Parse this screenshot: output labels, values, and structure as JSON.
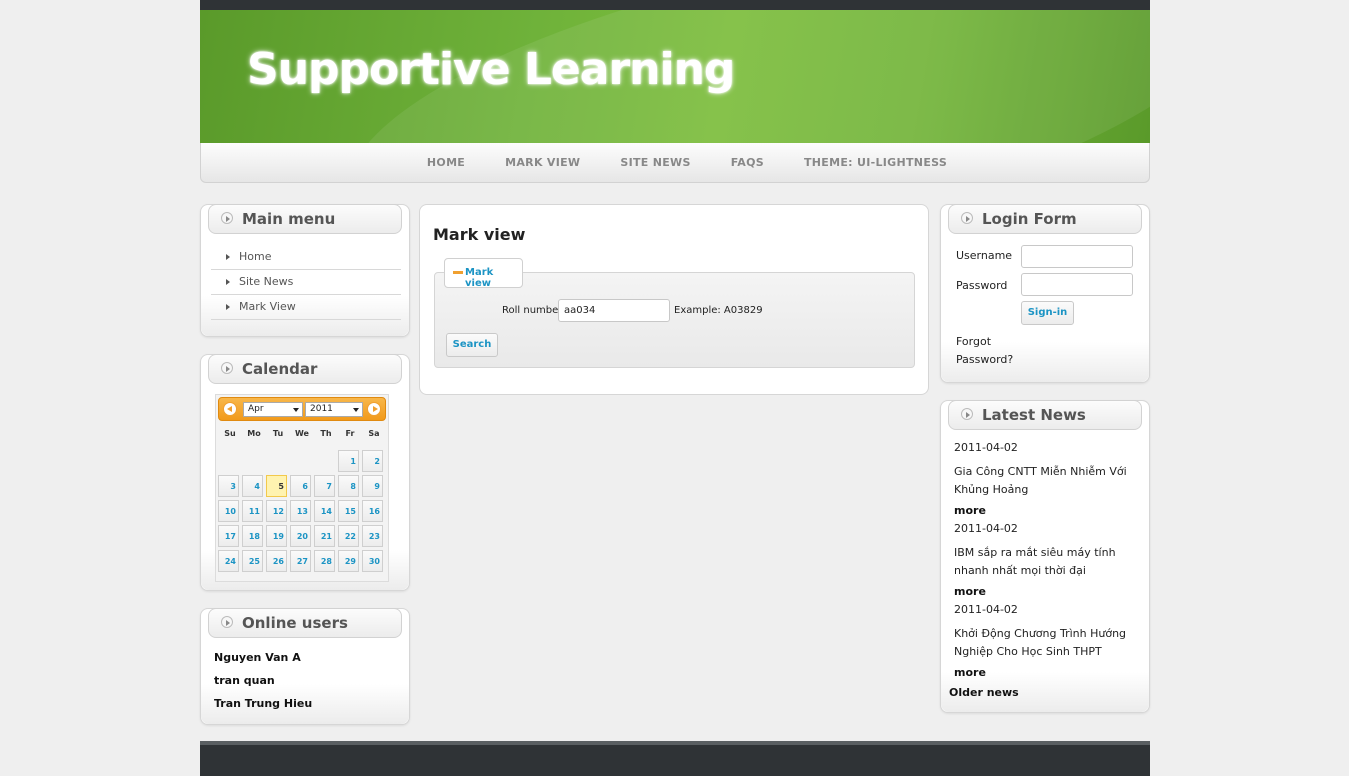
{
  "site": {
    "title": "Supportive Learning"
  },
  "nav": {
    "items": [
      "HOME",
      "MARK VIEW",
      "SITE NEWS",
      "FAQS",
      "THEME: UI-LIGHTNESS"
    ]
  },
  "main_menu": {
    "title": "Main menu",
    "items": [
      "Home",
      "Site News",
      "Mark View"
    ]
  },
  "calendar": {
    "title": "Calendar",
    "month": "Apr",
    "year": "2011",
    "weekdays": [
      "Su",
      "Mo",
      "Tu",
      "We",
      "Th",
      "Fr",
      "Sa"
    ],
    "first_weekday_index": 5,
    "days_in_month": 30,
    "today": 5
  },
  "online_users": {
    "title": "Online users",
    "users": [
      "Nguyen Van A",
      "tran quan",
      "Tran Trung Hieu"
    ]
  },
  "content": {
    "heading": "Mark view",
    "legend": "Mark view",
    "roll_label": "Roll number",
    "roll_value": "aa034",
    "example": "Example: A03829",
    "search_button": "Search"
  },
  "login": {
    "title": "Login Form",
    "username_label": "Username",
    "password_label": "Password",
    "signin_button": "Sign-in",
    "forgot": "Forgot Password?"
  },
  "latest_news": {
    "title": "Latest News",
    "items": [
      {
        "date": "2011-04-02",
        "title": "Gia Công CNTT Miễn Nhiễm Với Khủng Hoảng",
        "more": "more"
      },
      {
        "date": "2011-04-02",
        "title": "IBM sắp ra mắt siêu máy tính nhanh nhất mọi thời đại",
        "more": "more"
      },
      {
        "date": "2011-04-02",
        "title": "Khởi Động Chương Trình Hướng Nghiệp Cho Học Sinh THPT",
        "more": "more"
      }
    ],
    "older": "Older news"
  }
}
